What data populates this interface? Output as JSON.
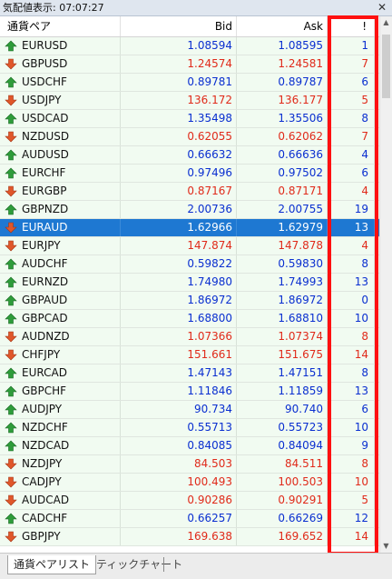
{
  "window": {
    "title": "気配値表示: 07:07:27"
  },
  "columns": {
    "symbol": "通貨ペア",
    "bid": "Bid",
    "ask": "Ask",
    "spread": "!"
  },
  "colors": {
    "up": "#0a2fd0",
    "down": "#e02a1a",
    "selected_row": "#1e78d2",
    "row_bg": "#f1fbf1",
    "highlight_border": "#ff1010"
  },
  "rows": [
    {
      "symbol": "EURUSD",
      "bid": "1.08594",
      "ask": "1.08595",
      "spread": "1",
      "dir": "up"
    },
    {
      "symbol": "GBPUSD",
      "bid": "1.24574",
      "ask": "1.24581",
      "spread": "7",
      "dir": "down"
    },
    {
      "symbol": "USDCHF",
      "bid": "0.89781",
      "ask": "0.89787",
      "spread": "6",
      "dir": "up"
    },
    {
      "symbol": "USDJPY",
      "bid": "136.172",
      "ask": "136.177",
      "spread": "5",
      "dir": "down"
    },
    {
      "symbol": "USDCAD",
      "bid": "1.35498",
      "ask": "1.35506",
      "spread": "8",
      "dir": "up"
    },
    {
      "symbol": "NZDUSD",
      "bid": "0.62055",
      "ask": "0.62062",
      "spread": "7",
      "dir": "down"
    },
    {
      "symbol": "AUDUSD",
      "bid": "0.66632",
      "ask": "0.66636",
      "spread": "4",
      "dir": "up"
    },
    {
      "symbol": "EURCHF",
      "bid": "0.97496",
      "ask": "0.97502",
      "spread": "6",
      "dir": "up"
    },
    {
      "symbol": "EURGBP",
      "bid": "0.87167",
      "ask": "0.87171",
      "spread": "4",
      "dir": "down"
    },
    {
      "symbol": "GBPNZD",
      "bid": "2.00736",
      "ask": "2.00755",
      "spread": "19",
      "dir": "up"
    },
    {
      "symbol": "EURAUD",
      "bid": "1.62966",
      "ask": "1.62979",
      "spread": "13",
      "dir": "down",
      "selected": true
    },
    {
      "symbol": "EURJPY",
      "bid": "147.874",
      "ask": "147.878",
      "spread": "4",
      "dir": "down"
    },
    {
      "symbol": "AUDCHF",
      "bid": "0.59822",
      "ask": "0.59830",
      "spread": "8",
      "dir": "up"
    },
    {
      "symbol": "EURNZD",
      "bid": "1.74980",
      "ask": "1.74993",
      "spread": "13",
      "dir": "up"
    },
    {
      "symbol": "GBPAUD",
      "bid": "1.86972",
      "ask": "1.86972",
      "spread": "0",
      "dir": "up"
    },
    {
      "symbol": "GBPCAD",
      "bid": "1.68800",
      "ask": "1.68810",
      "spread": "10",
      "dir": "up"
    },
    {
      "symbol": "AUDNZD",
      "bid": "1.07366",
      "ask": "1.07374",
      "spread": "8",
      "dir": "down"
    },
    {
      "symbol": "CHFJPY",
      "bid": "151.661",
      "ask": "151.675",
      "spread": "14",
      "dir": "down"
    },
    {
      "symbol": "EURCAD",
      "bid": "1.47143",
      "ask": "1.47151",
      "spread": "8",
      "dir": "up"
    },
    {
      "symbol": "GBPCHF",
      "bid": "1.11846",
      "ask": "1.11859",
      "spread": "13",
      "dir": "up"
    },
    {
      "symbol": "AUDJPY",
      "bid": "90.734",
      "ask": "90.740",
      "spread": "6",
      "dir": "up"
    },
    {
      "symbol": "NZDCHF",
      "bid": "0.55713",
      "ask": "0.55723",
      "spread": "10",
      "dir": "up"
    },
    {
      "symbol": "NZDCAD",
      "bid": "0.84085",
      "ask": "0.84094",
      "spread": "9",
      "dir": "up"
    },
    {
      "symbol": "NZDJPY",
      "bid": "84.503",
      "ask": "84.511",
      "spread": "8",
      "dir": "down"
    },
    {
      "symbol": "CADJPY",
      "bid": "100.493",
      "ask": "100.503",
      "spread": "10",
      "dir": "down"
    },
    {
      "symbol": "AUDCAD",
      "bid": "0.90286",
      "ask": "0.90291",
      "spread": "5",
      "dir": "down"
    },
    {
      "symbol": "CADCHF",
      "bid": "0.66257",
      "ask": "0.66269",
      "spread": "12",
      "dir": "up"
    },
    {
      "symbol": "GBPJPY",
      "bid": "169.638",
      "ask": "169.652",
      "spread": "14",
      "dir": "down"
    }
  ],
  "tabs": [
    {
      "label": "通貨ペアリスト",
      "active": true
    },
    {
      "label": "ティックチャート",
      "active": false
    }
  ]
}
